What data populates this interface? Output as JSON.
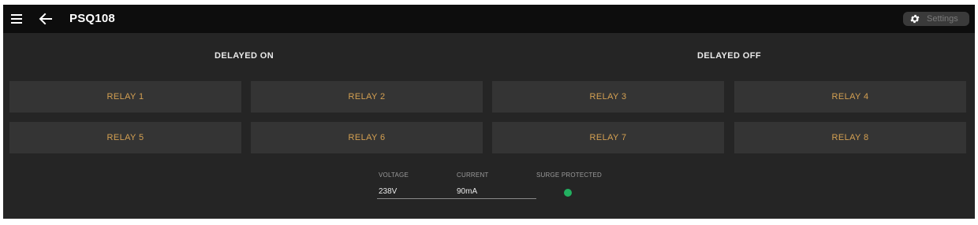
{
  "header": {
    "title": "PSQ108",
    "settings_label": "Settings",
    "icons": {
      "menu": "menu-icon",
      "back": "arrow-left-icon",
      "settings": "gear-icon"
    }
  },
  "groups": {
    "delayed_on": "DELAYED ON",
    "delayed_off": "DELAYED OFF"
  },
  "relays": [
    {
      "label": "RELAY 1"
    },
    {
      "label": "RELAY 2"
    },
    {
      "label": "RELAY 3"
    },
    {
      "label": "RELAY 4"
    },
    {
      "label": "RELAY 5"
    },
    {
      "label": "RELAY 6"
    },
    {
      "label": "RELAY 7"
    },
    {
      "label": "RELAY 8"
    }
  ],
  "status": {
    "voltage_label": "VOLTAGE",
    "voltage_value": "238V",
    "current_label": "CURRENT",
    "current_value": "90mA",
    "surge_label": "SURGE PROTECTED",
    "surge_color": "#22b060"
  },
  "colors": {
    "background": "#252525",
    "topbar": "#0d0d0d",
    "tile": "#343434",
    "accent": "#d4a052"
  }
}
